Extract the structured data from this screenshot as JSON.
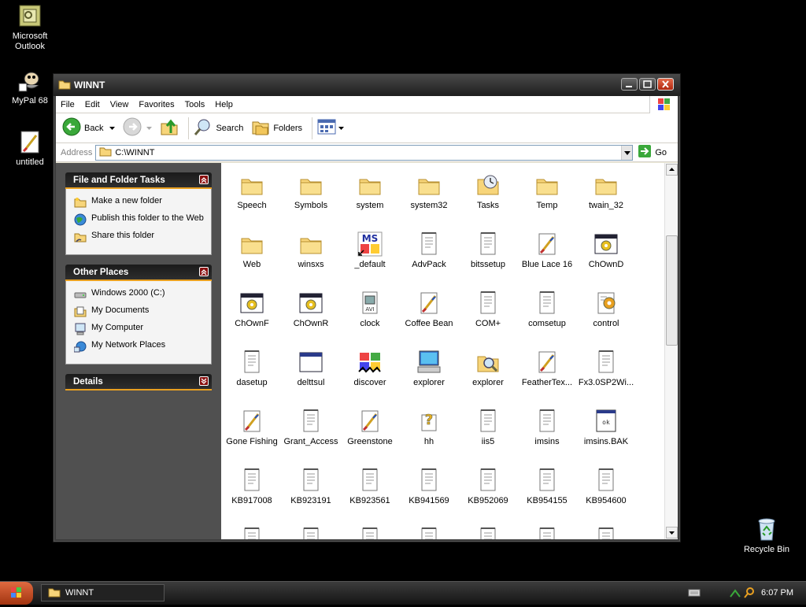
{
  "desktop": {
    "icons": [
      {
        "label": "Microsoft Outlook"
      },
      {
        "label": "MyPal 68"
      },
      {
        "label": "untitled"
      }
    ],
    "recycle_bin": "Recycle Bin"
  },
  "window": {
    "title": "WINNT",
    "menu": [
      "File",
      "Edit",
      "View",
      "Favorites",
      "Tools",
      "Help"
    ],
    "toolbar": {
      "back": "Back",
      "search": "Search",
      "folders": "Folders"
    },
    "address": {
      "label": "Address",
      "value": "C:\\WINNT",
      "go": "Go"
    }
  },
  "tasks": {
    "file_folder": {
      "title": "File and Folder Tasks",
      "items": [
        "Make a new folder",
        "Publish this folder to the Web",
        "Share this folder"
      ]
    },
    "other_places": {
      "title": "Other Places",
      "items": [
        "Windows 2000 (C:)",
        "My Documents",
        "My Computer",
        "My Network Places"
      ]
    },
    "details": {
      "title": "Details"
    }
  },
  "files": [
    {
      "name": "Speech",
      "icon": "folder"
    },
    {
      "name": "Symbols",
      "icon": "folder"
    },
    {
      "name": "system",
      "icon": "folder"
    },
    {
      "name": "system32",
      "icon": "folder"
    },
    {
      "name": "Tasks",
      "icon": "folder-clock"
    },
    {
      "name": "Temp",
      "icon": "folder"
    },
    {
      "name": "twain_32",
      "icon": "folder"
    },
    {
      "name": "Web",
      "icon": "folder"
    },
    {
      "name": "winsxs",
      "icon": "folder"
    },
    {
      "name": "_default",
      "icon": "msdos"
    },
    {
      "name": "AdvPack",
      "icon": "doc"
    },
    {
      "name": "bitssetup",
      "icon": "doc"
    },
    {
      "name": "Blue Lace 16",
      "icon": "paint"
    },
    {
      "name": "ChOwnD",
      "icon": "app"
    },
    {
      "name": "ChOwnF",
      "icon": "app"
    },
    {
      "name": "ChOwnR",
      "icon": "app"
    },
    {
      "name": "clock",
      "icon": "avi"
    },
    {
      "name": "Coffee Bean",
      "icon": "paint"
    },
    {
      "name": "COM+",
      "icon": "doc"
    },
    {
      "name": "comsetup",
      "icon": "doc"
    },
    {
      "name": "control",
      "icon": "control"
    },
    {
      "name": "dasetup",
      "icon": "doc"
    },
    {
      "name": "delttsul",
      "icon": "window"
    },
    {
      "name": "discover",
      "icon": "flag"
    },
    {
      "name": "explorer",
      "icon": "computer"
    },
    {
      "name": "explorer",
      "icon": "folder-search"
    },
    {
      "name": "FeatherTex...",
      "icon": "paint"
    },
    {
      "name": "Fx3.0SP2Wi...",
      "icon": "doc"
    },
    {
      "name": "Gone Fishing",
      "icon": "paint"
    },
    {
      "name": "Grant_Access",
      "icon": "doc"
    },
    {
      "name": "Greenstone",
      "icon": "paint"
    },
    {
      "name": "hh",
      "icon": "help"
    },
    {
      "name": "iis5",
      "icon": "doc"
    },
    {
      "name": "imsins",
      "icon": "doc"
    },
    {
      "name": "imsins.BAK",
      "icon": "bak"
    },
    {
      "name": "KB917008",
      "icon": "doc"
    },
    {
      "name": "KB923191",
      "icon": "doc"
    },
    {
      "name": "KB923561",
      "icon": "doc"
    },
    {
      "name": "KB941569",
      "icon": "doc"
    },
    {
      "name": "KB952069",
      "icon": "doc"
    },
    {
      "name": "KB954155",
      "icon": "doc"
    },
    {
      "name": "KB954600",
      "icon": "doc"
    },
    {
      "name": "",
      "icon": "doc"
    },
    {
      "name": "",
      "icon": "doc"
    },
    {
      "name": "",
      "icon": "doc"
    },
    {
      "name": "",
      "icon": "doc"
    },
    {
      "name": "",
      "icon": "doc"
    },
    {
      "name": "",
      "icon": "doc"
    },
    {
      "name": "",
      "icon": "doc"
    }
  ],
  "taskbar": {
    "task": "WINNT",
    "clock": "6:07 PM"
  },
  "colors": {
    "accent": "#e9a021",
    "folder": "#f7d57a",
    "desktop": "#000000"
  }
}
